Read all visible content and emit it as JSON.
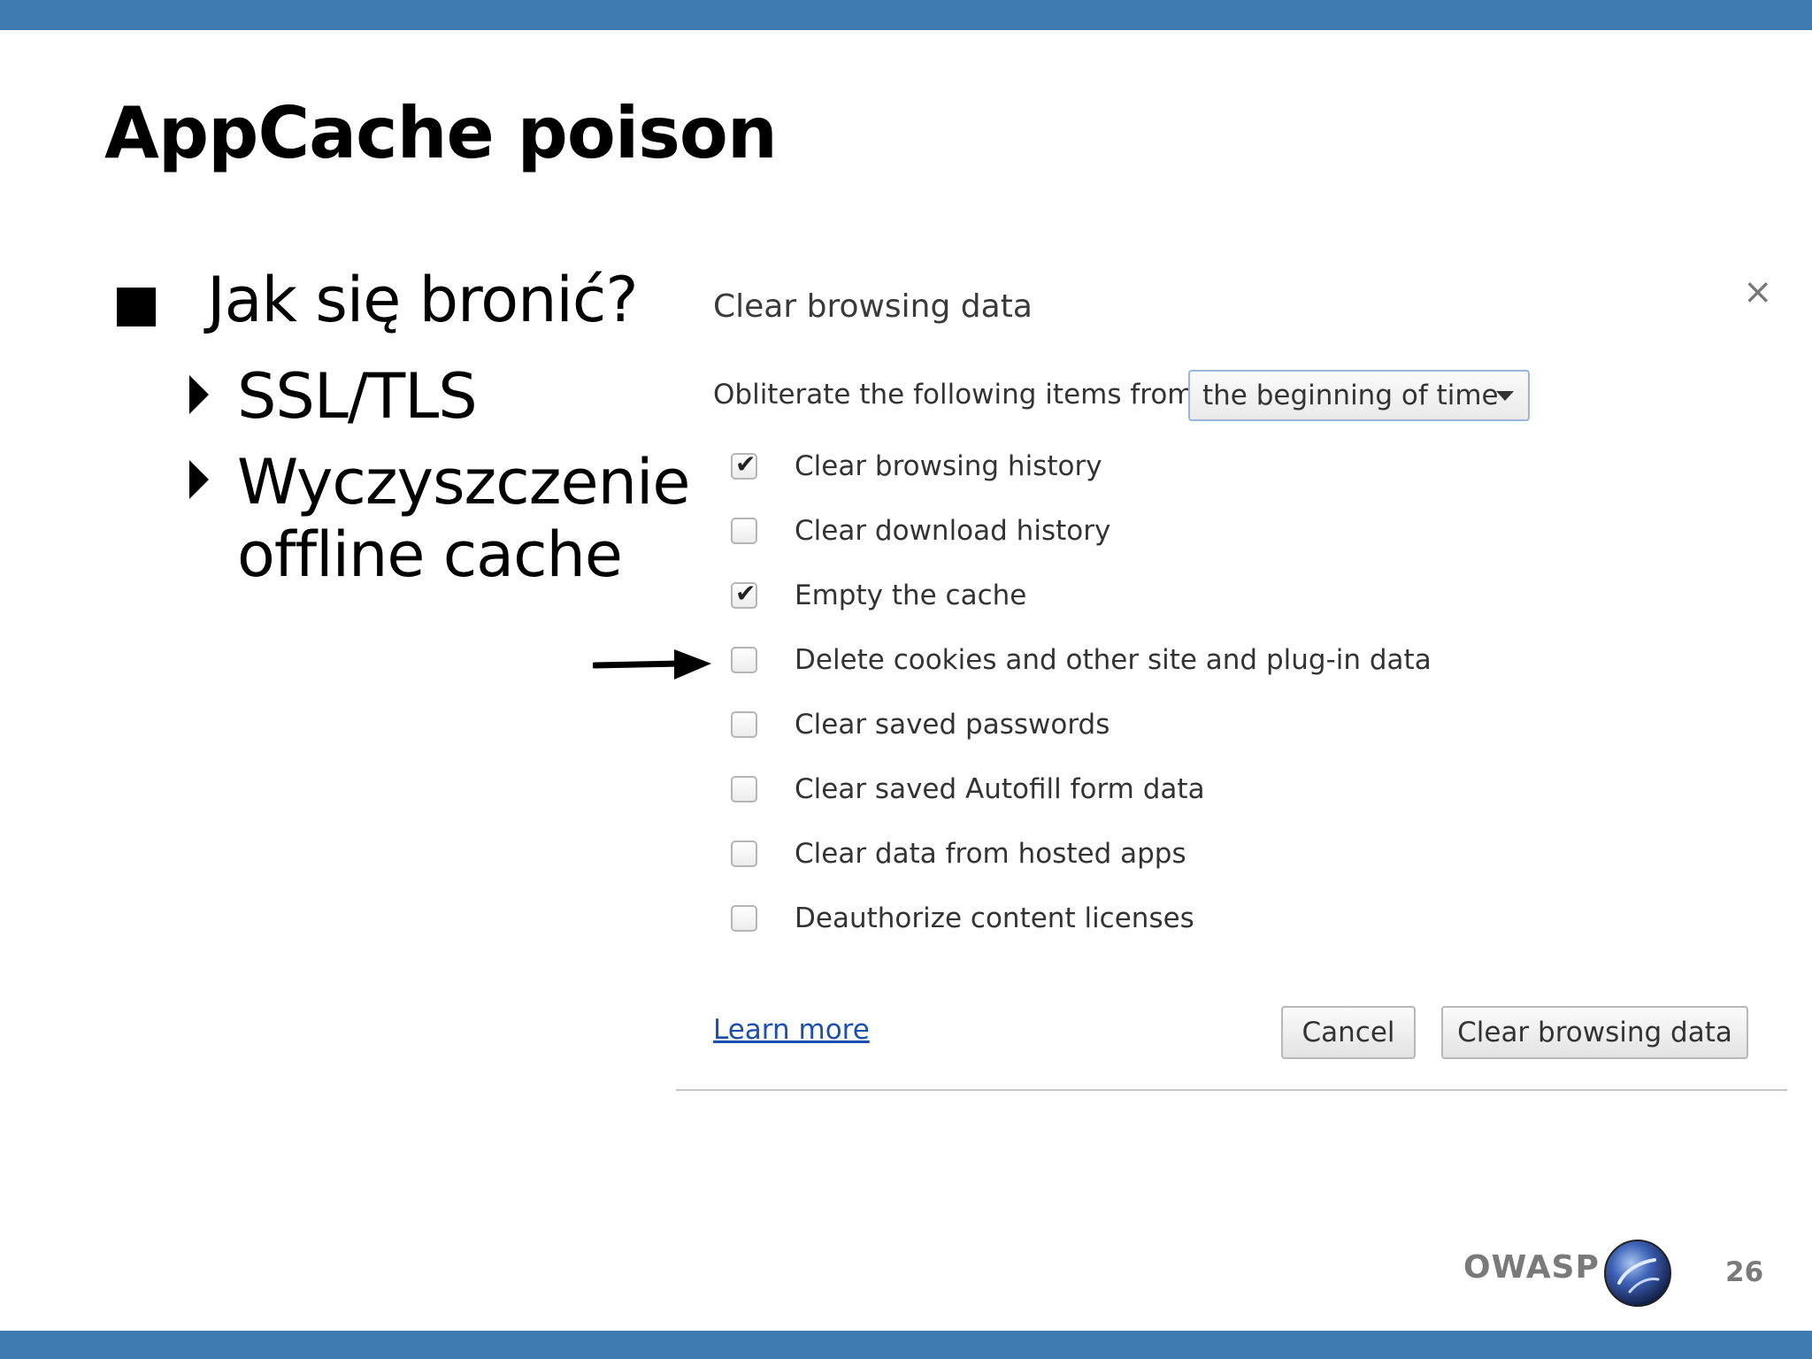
{
  "slide": {
    "title": "AppCache poison",
    "bullet": "Jak się bronić?",
    "sub_bullets": [
      {
        "text": "SSL/TLS"
      },
      {
        "text": "Wyczyszczenie offline cache"
      }
    ],
    "page_number": "26",
    "brand": "OWASP",
    "colors": {
      "bar": "#3d7aaf",
      "link": "#1b4fb0"
    }
  },
  "dialog": {
    "title": "Clear browsing data",
    "close_icon": "close-icon",
    "obliterate_label": "Obliterate the following items from:",
    "time_range": {
      "selected": "the beginning of time"
    },
    "options": [
      {
        "label": "Clear browsing history",
        "checked": true
      },
      {
        "label": "Clear download history",
        "checked": false
      },
      {
        "label": "Empty the cache",
        "checked": true
      },
      {
        "label": "Delete cookies and other site and plug-in data",
        "checked": false
      },
      {
        "label": "Clear saved passwords",
        "checked": false
      },
      {
        "label": "Clear saved Autofill form data",
        "checked": false
      },
      {
        "label": "Clear data from hosted apps",
        "checked": false
      },
      {
        "label": "Deauthorize content licenses",
        "checked": false
      }
    ],
    "learn_more": "Learn more",
    "cancel_label": "Cancel",
    "confirm_label": "Clear browsing data"
  }
}
